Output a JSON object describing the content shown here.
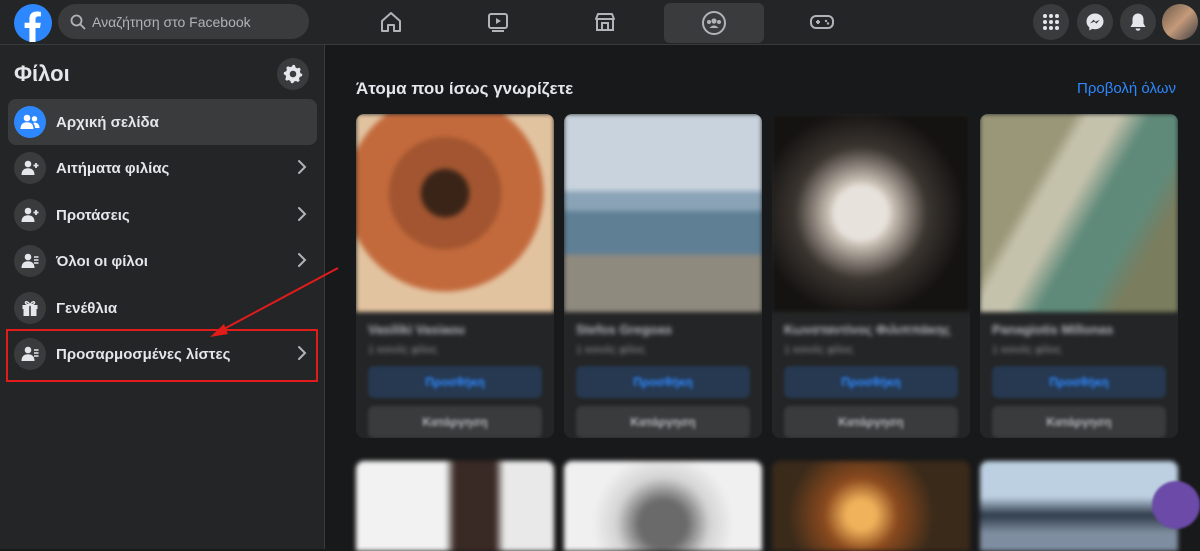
{
  "search": {
    "placeholder": "Αναζήτηση στο Facebook"
  },
  "nav": {
    "tabs": [
      {
        "icon": "home-icon"
      },
      {
        "icon": "watch-icon"
      },
      {
        "icon": "marketplace-icon"
      },
      {
        "icon": "groups-icon",
        "active": true
      },
      {
        "icon": "gaming-icon"
      }
    ]
  },
  "sidebar": {
    "title": "Φίλοι",
    "items": [
      {
        "label": "Αρχική σελίδα",
        "icon": "friends-home-icon",
        "active": true
      },
      {
        "label": "Αιτήματα φιλίας",
        "icon": "friend-requests-icon",
        "chevron": true
      },
      {
        "label": "Προτάσεις",
        "icon": "suggestions-icon",
        "chevron": true
      },
      {
        "label": "Όλοι οι φίλοι",
        "icon": "all-friends-icon",
        "chevron": true
      },
      {
        "label": "Γενέθλια",
        "icon": "gift-icon"
      },
      {
        "label": "Προσαρμοσμένες λίστες",
        "icon": "custom-lists-icon",
        "chevron": true
      }
    ]
  },
  "main": {
    "title": "Άτομα που ίσως γνωρίζετε",
    "see_all": "Προβολή όλων",
    "cards": [
      {
        "name": "Vasiliki Vasiaou",
        "mutual": "1 κοινός φίλος",
        "add": "Προσθήκη",
        "remove": "Κατάργηση"
      },
      {
        "name": "Stefos Gregoas",
        "mutual": "1 κοινός φίλος",
        "add": "Προσθήκη",
        "remove": "Κατάργηση"
      },
      {
        "name": "Κωνσταντίνος Φιλιππάκης",
        "mutual": "1 κοινός φίλος",
        "add": "Προσθήκη",
        "remove": "Κατάργηση"
      },
      {
        "name": "Panagiotis Millonas",
        "mutual": "1 κοινός φίλος",
        "add": "Προσθήκη",
        "remove": "Κατάργηση"
      }
    ]
  },
  "colors": {
    "accent": "#2d88ff",
    "highlight": "#e21b1b",
    "background": "#18191a",
    "surface": "#242526"
  }
}
